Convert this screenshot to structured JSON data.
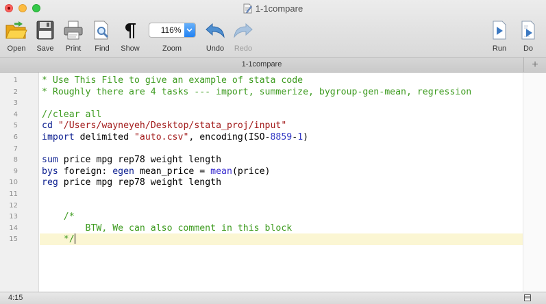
{
  "window": {
    "title": "1-1compare"
  },
  "toolbar": {
    "open": "Open",
    "save": "Save",
    "print": "Print",
    "find": "Find",
    "show": "Show",
    "zoom": "Zoom",
    "zoom_value": "116%",
    "undo": "Undo",
    "redo": "Redo",
    "run": "Run",
    "do": "Do"
  },
  "tab": {
    "label": "1-1compare",
    "add": "+"
  },
  "editor": {
    "lines": [
      {
        "n": "1",
        "parts": [
          {
            "t": "* Use This File to give an example of stata code",
            "c": "comment"
          }
        ]
      },
      {
        "n": "2",
        "parts": [
          {
            "t": "* Roughly there are 4 tasks --- import, summerize, bygroup-gen-mean, regression",
            "c": "comment"
          }
        ]
      },
      {
        "n": "3",
        "parts": []
      },
      {
        "n": "4",
        "parts": [
          {
            "t": "//clear all",
            "c": "comment"
          }
        ]
      },
      {
        "n": "5",
        "parts": [
          {
            "t": "cd",
            "c": "kw"
          },
          {
            "t": " ",
            "c": ""
          },
          {
            "t": "\"/Users/wayneyeh/Desktop/stata_proj/input\"",
            "c": "str"
          }
        ]
      },
      {
        "n": "6",
        "parts": [
          {
            "t": "import",
            "c": "kw"
          },
          {
            "t": " delimited ",
            "c": ""
          },
          {
            "t": "\"auto.csv\"",
            "c": "str"
          },
          {
            "t": ", encoding(ISO-",
            "c": ""
          },
          {
            "t": "8859",
            "c": "num"
          },
          {
            "t": "-",
            "c": ""
          },
          {
            "t": "1",
            "c": "num"
          },
          {
            "t": ")",
            "c": ""
          }
        ]
      },
      {
        "n": "7",
        "parts": []
      },
      {
        "n": "8",
        "parts": [
          {
            "t": "sum",
            "c": "kw"
          },
          {
            "t": " price mpg rep78 weight length",
            "c": ""
          }
        ]
      },
      {
        "n": "9",
        "parts": [
          {
            "t": "bys",
            "c": "kw"
          },
          {
            "t": " foreign: ",
            "c": ""
          },
          {
            "t": "egen",
            "c": "kw"
          },
          {
            "t": " mean_price = ",
            "c": ""
          },
          {
            "t": "mean",
            "c": "fn"
          },
          {
            "t": "(price)",
            "c": ""
          }
        ]
      },
      {
        "n": "10",
        "parts": [
          {
            "t": "reg",
            "c": "kw"
          },
          {
            "t": " price mpg rep78 weight length",
            "c": ""
          }
        ]
      },
      {
        "n": "11",
        "parts": []
      },
      {
        "n": "12",
        "parts": []
      },
      {
        "n": "13",
        "parts": [
          {
            "t": "    /*",
            "c": "comment"
          }
        ]
      },
      {
        "n": "14",
        "parts": [
          {
            "t": "        BTW, We can also comment in this block",
            "c": "comment"
          }
        ]
      },
      {
        "n": "15",
        "parts": [
          {
            "t": "    */",
            "c": "comment"
          }
        ],
        "current": true
      }
    ]
  },
  "status": {
    "position": "4:15"
  }
}
